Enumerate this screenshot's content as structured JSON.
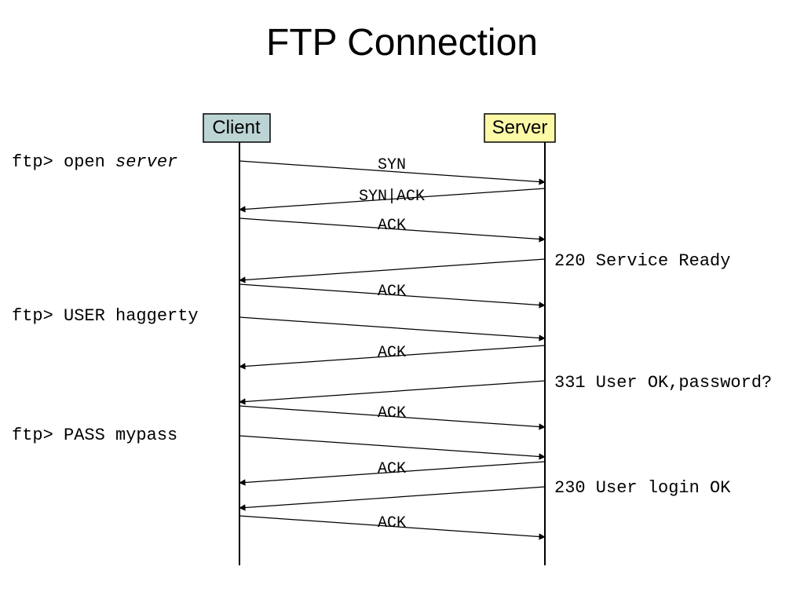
{
  "title": "FTP Connection",
  "client_label": "Client",
  "server_label": "Server",
  "left_annotations": {
    "open_prefix": "ftp> open ",
    "open_arg": "server",
    "user": "ftp> USER haggerty",
    "pass": "ftp> PASS mypass"
  },
  "right_annotations": {
    "r220": "220 Service Ready",
    "r331": "331 User OK,password?",
    "r230": "230 User login OK"
  },
  "messages": {
    "syn": "SYN",
    "synack": "SYN|ACK",
    "ack1": "ACK",
    "ack2": "ACK",
    "ack3": "ACK",
    "ack4": "ACK",
    "ack5": "ACK",
    "ack6": "ACK"
  }
}
